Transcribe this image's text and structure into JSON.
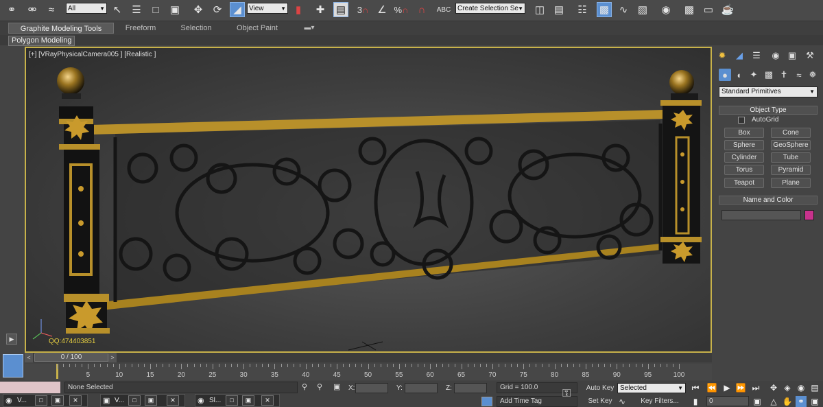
{
  "toolbar": {
    "selection_filter": "All",
    "ref_coord_system": "View",
    "snap_labels": [
      "3",
      "°",
      "%"
    ],
    "named_selection_set": "Create Selection Se"
  },
  "ribbon": {
    "tabs": [
      "Graphite Modeling Tools",
      "Freeform",
      "Selection",
      "Object Paint"
    ],
    "sub_label": "Polygon Modeling"
  },
  "viewport": {
    "label": "[+] [VRayPhysicalCamera005 ] [Realistic ]",
    "watermark": "QQ:474403851"
  },
  "command_panel": {
    "category": "Standard Primitives",
    "object_type_title": "Object Type",
    "autogrid_label": "AutoGrid",
    "buttons": [
      "Box",
      "Cone",
      "Sphere",
      "GeoSphere",
      "Cylinder",
      "Tube",
      "Torus",
      "Pyramid",
      "Teapot",
      "Plane"
    ],
    "name_color_title": "Name and Color",
    "object_name": "",
    "swatch_color": "#c8328c"
  },
  "timeline": {
    "frame_counter": "0 / 100",
    "prev_label": "<",
    "next_label": ">",
    "tick_labels": [
      "5",
      "10",
      "15",
      "20",
      "25",
      "30",
      "35",
      "40",
      "45",
      "50",
      "55",
      "60",
      "65",
      "70",
      "75",
      "80",
      "85",
      "90",
      "95",
      "100"
    ]
  },
  "status": {
    "selection": "None Selected",
    "x_label": "X:",
    "y_label": "Y:",
    "z_label": "Z:",
    "grid": "Grid = 100.0",
    "add_time_tag": "Add Time Tag",
    "auto_key": "Auto Key",
    "set_key": "Set Key",
    "key_mode": "Selected",
    "key_filters": "Key Filters...",
    "current_frame": "0"
  },
  "taskbar": {
    "items": [
      {
        "label": "V...",
        "icon": "app-icon"
      },
      {
        "label": "V...",
        "icon": "window-icon"
      },
      {
        "label": "Sl...",
        "icon": "app-icon"
      }
    ]
  },
  "colors": {
    "viewport_border": "#c8b24a",
    "active_blue": "#5b8fd0",
    "gold": "#b8902a"
  }
}
